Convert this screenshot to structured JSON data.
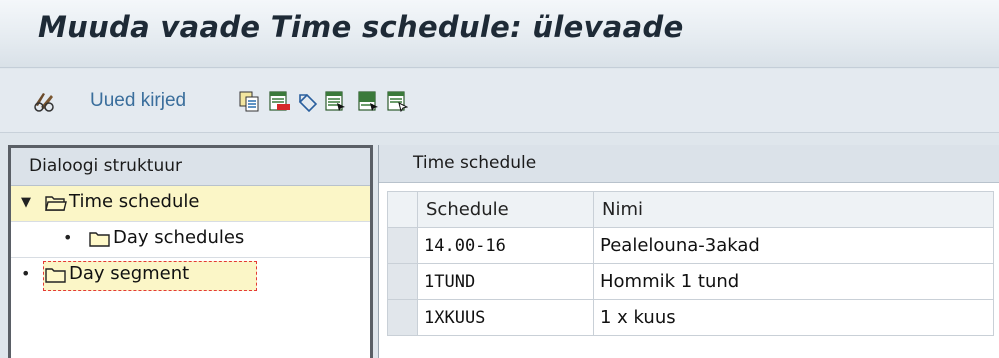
{
  "window": {
    "title": "Muuda vaade Time schedule: ülevaade"
  },
  "toolbar": {
    "new_entries_label": "Uued kirjed",
    "icons": [
      "display-change-icon",
      "copy-icon",
      "delete-icon",
      "undo-icon",
      "select-all-icon",
      "select-block-icon",
      "deselect-all-icon"
    ]
  },
  "dialog_structure": {
    "header": "Dialoogi struktuur",
    "items": [
      {
        "label": "Time schedule",
        "level": 0,
        "expanded": true,
        "selected": true
      },
      {
        "label": "Day schedules",
        "level": 1
      },
      {
        "label": "Day segment",
        "level": 0,
        "focused": true
      }
    ]
  },
  "table": {
    "title": "Time schedule",
    "columns": [
      "Schedule",
      "Nimi"
    ],
    "rows": [
      {
        "schedule": "14.00-16",
        "name": "Pealelouna-3akad"
      },
      {
        "schedule": "1TUND",
        "name": "Hommik 1 tund"
      },
      {
        "schedule": "1XKUUS",
        "name": "1 x kuus"
      }
    ]
  },
  "colors": {
    "title_text": "#1e2a36",
    "link_text": "#3a6e9c",
    "selection_bg": "#fbf6c7",
    "focus_border": "#e53935"
  }
}
